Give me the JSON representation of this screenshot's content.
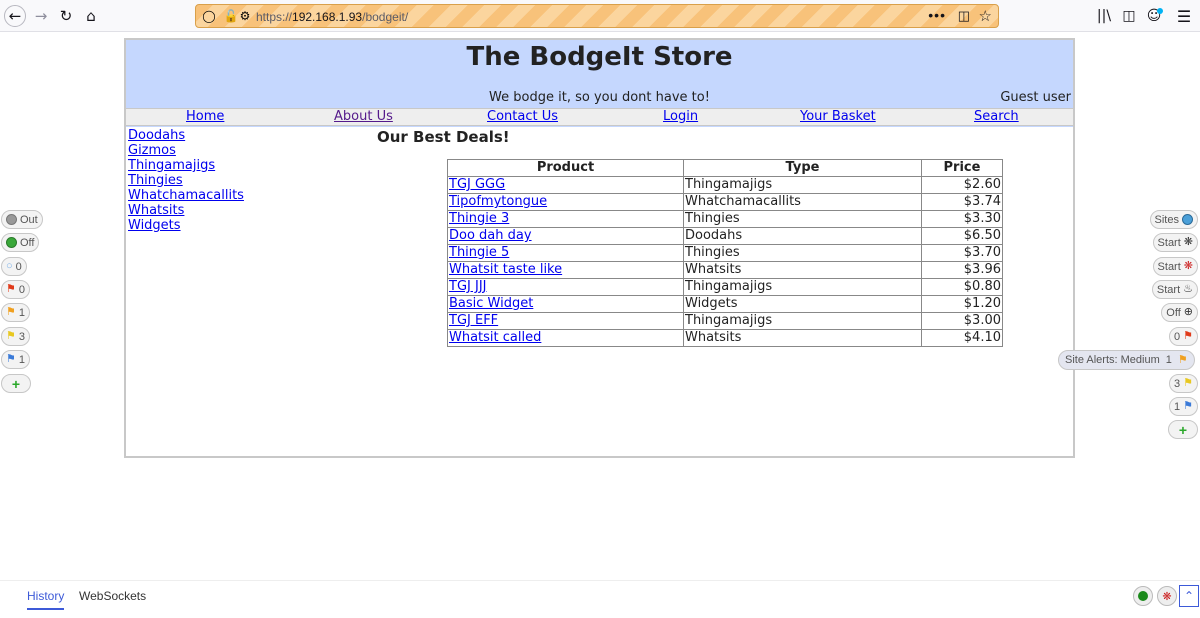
{
  "browser": {
    "url_scheme": "https://",
    "url_host": "192.168.1.93",
    "url_path": "/bodgeit/",
    "more_label": "•••"
  },
  "store": {
    "title": "The BodgeIt Store",
    "tagline": "We bodge it, so you dont have to!",
    "user_label": "Guest user",
    "nav": {
      "home": "Home",
      "about": "About Us",
      "contact": "Contact Us",
      "login": "Login",
      "basket": "Your Basket",
      "search": "Search"
    },
    "categories": [
      "Doodahs",
      "Gizmos",
      "Thingamajigs",
      "Thingies",
      "Whatchamacallits",
      "Whatsits",
      "Widgets"
    ],
    "deals_title": "Our Best Deals!",
    "table": {
      "headers": [
        "Product",
        "Type",
        "Price"
      ],
      "rows": [
        [
          "TGJ GGG",
          "Thingamajigs",
          "$2.60"
        ],
        [
          "Tipofmytongue",
          "Whatchamacallits",
          "$3.74"
        ],
        [
          "Thingie 3",
          "Thingies",
          "$3.30"
        ],
        [
          "Doo dah day",
          "Doodahs",
          "$6.50"
        ],
        [
          "Thingie 5",
          "Thingies",
          "$3.70"
        ],
        [
          "Whatsit taste like",
          "Whatsits",
          "$3.96"
        ],
        [
          "TGJ JJJ",
          "Thingamajigs",
          "$0.80"
        ],
        [
          "Basic Widget",
          "Widgets",
          "$1.20"
        ],
        [
          "TGJ EFF",
          "Thingamajigs",
          "$3.00"
        ],
        [
          "Whatsit called",
          "Whatsits",
          "$4.10"
        ]
      ]
    }
  },
  "hud_left": {
    "break": "Out",
    "show": "Off",
    "info": "0",
    "high": "0",
    "medium": "1",
    "low": "3",
    "informational": "1"
  },
  "hud_right": {
    "sites": "Sites",
    "spider": "Start",
    "ajax": "Start",
    "active": "Start",
    "attack": "Off",
    "high": "0",
    "medium_label": "Site Alerts: Medium",
    "medium": "1",
    "low": "3",
    "informational": "1"
  },
  "drawer": {
    "tab_history": "History",
    "tab_websockets": "WebSockets"
  },
  "colors": {
    "header_bg": "#c5d7fe",
    "link": "#0000ee",
    "visited_link": "#551a8b",
    "url_bar": "#f8c27a"
  }
}
